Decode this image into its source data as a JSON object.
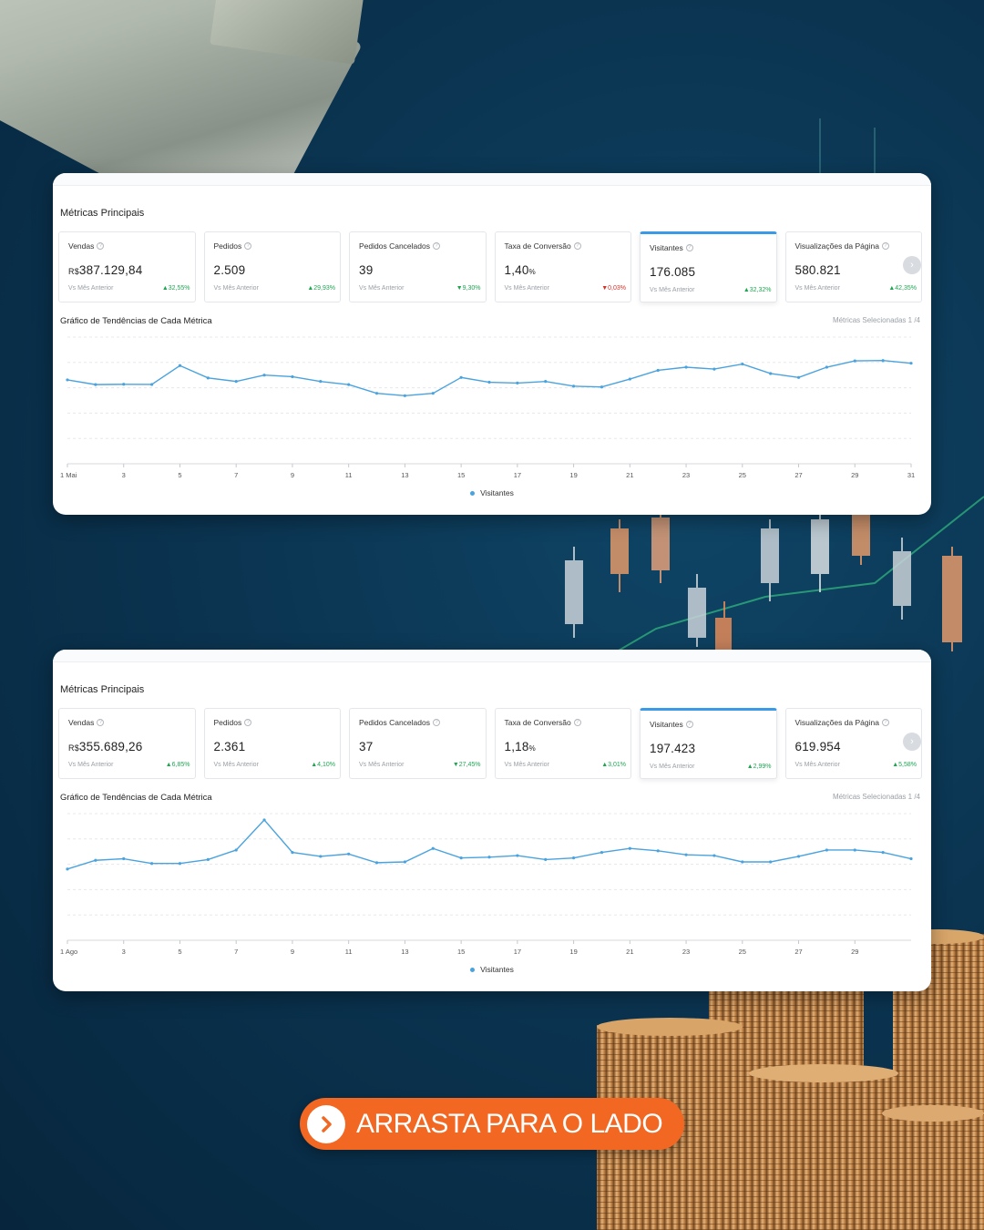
{
  "colors": {
    "accent": "#3b9ae8",
    "line": "#4aa3df",
    "up": "#1fa653",
    "down": "#d93025",
    "cta": "#f26722"
  },
  "panels": [
    {
      "section_title": "Métricas Principais",
      "cards": [
        {
          "label": "Vendas",
          "currency": "R$",
          "value": "387.129,84",
          "unit": "",
          "sub": "Vs Mês Anterior",
          "delta": "32,55%",
          "dir": "up",
          "active": false
        },
        {
          "label": "Pedidos",
          "currency": "",
          "value": "2.509",
          "unit": "",
          "sub": "Vs Mês Anterior",
          "delta": "29,93%",
          "dir": "up",
          "active": false
        },
        {
          "label": "Pedidos Cancelados",
          "currency": "",
          "value": "39",
          "unit": "",
          "sub": "Vs Mês Anterior",
          "delta": "9,30%",
          "dir": "down-green",
          "active": false
        },
        {
          "label": "Taxa de Conversão",
          "currency": "",
          "value": "1,40",
          "unit": "%",
          "sub": "Vs Mês Anterior",
          "delta": "0,03%",
          "dir": "down",
          "active": false
        },
        {
          "label": "Visitantes",
          "currency": "",
          "value": "176.085",
          "unit": "",
          "sub": "Vs Mês Anterior",
          "delta": "32,32%",
          "dir": "up",
          "active": true
        },
        {
          "label": "Visualizações da Página",
          "currency": "",
          "value": "580.821",
          "unit": "",
          "sub": "Vs Mês Anterior",
          "delta": "42,35%",
          "dir": "up",
          "active": false
        }
      ],
      "chart_title": "Gráfico de Tendências de Cada Métrica",
      "chart_selected": "Métricas Selecionadas 1 /4",
      "legend": "Visitantes",
      "next_icon": "chevron-right-icon"
    },
    {
      "section_title": "Métricas Principais",
      "cards": [
        {
          "label": "Vendas",
          "currency": "R$",
          "value": "355.689,26",
          "unit": "",
          "sub": "Vs Mês Anterior",
          "delta": "6,85%",
          "dir": "up",
          "active": false
        },
        {
          "label": "Pedidos",
          "currency": "",
          "value": "2.361",
          "unit": "",
          "sub": "Vs Mês Anterior",
          "delta": "4,10%",
          "dir": "up",
          "active": false
        },
        {
          "label": "Pedidos Cancelados",
          "currency": "",
          "value": "37",
          "unit": "",
          "sub": "Vs Mês Anterior",
          "delta": "27,45%",
          "dir": "down-green",
          "active": false
        },
        {
          "label": "Taxa de Conversão",
          "currency": "",
          "value": "1,18",
          "unit": "%",
          "sub": "Vs Mês Anterior",
          "delta": "3,01%",
          "dir": "up",
          "active": false
        },
        {
          "label": "Visitantes",
          "currency": "",
          "value": "197.423",
          "unit": "",
          "sub": "Vs Mês Anterior",
          "delta": "2,99%",
          "dir": "up",
          "active": true
        },
        {
          "label": "Visualizações da Página",
          "currency": "",
          "value": "619.954",
          "unit": "",
          "sub": "Vs Mês Anterior",
          "delta": "5,58%",
          "dir": "up",
          "active": false
        }
      ],
      "chart_title": "Gráfico de Tendências de Cada Métrica",
      "chart_selected": "Métricas Selecionadas 1 /4",
      "legend": "Visitantes",
      "next_icon": "chevron-right-icon"
    }
  ],
  "chart_data": [
    {
      "type": "line",
      "x": [
        1,
        2,
        3,
        4,
        5,
        6,
        7,
        8,
        9,
        10,
        11,
        12,
        13,
        14,
        15,
        16,
        17,
        18,
        19,
        20,
        21,
        22,
        23,
        24,
        25,
        26,
        27,
        28,
        29,
        30,
        31
      ],
      "tick_labels": [
        "1 Mai",
        "3",
        "5",
        "7",
        "9",
        "11",
        "13",
        "15",
        "17",
        "19",
        "21",
        "23",
        "25",
        "27",
        "29",
        "31"
      ],
      "tick_positions": [
        1,
        3,
        5,
        7,
        9,
        11,
        13,
        15,
        17,
        19,
        21,
        23,
        25,
        27,
        29,
        31
      ],
      "series": [
        {
          "name": "Visitantes",
          "values": [
            5300,
            5000,
            5020,
            5010,
            6200,
            5420,
            5200,
            5600,
            5500,
            5200,
            5000,
            4450,
            4300,
            4450,
            5450,
            5150,
            5100,
            5200,
            4900,
            4850,
            5350,
            5900,
            6100,
            5980,
            6300,
            5700,
            5450,
            6100,
            6500,
            6520,
            6350
          ]
        }
      ],
      "ylim": [
        0,
        8000
      ]
    },
    {
      "type": "line",
      "x": [
        1,
        2,
        3,
        4,
        5,
        6,
        7,
        8,
        9,
        10,
        11,
        12,
        13,
        14,
        15,
        16,
        17,
        18,
        19,
        20,
        21,
        22,
        23,
        24,
        25,
        26,
        27,
        28,
        29,
        30,
        31
      ],
      "tick_labels": [
        "1 Ago",
        "3",
        "5",
        "7",
        "9",
        "11",
        "13",
        "15",
        "17",
        "19",
        "21",
        "23",
        "25",
        "27",
        "29"
      ],
      "tick_positions": [
        1,
        3,
        5,
        7,
        9,
        11,
        13,
        15,
        17,
        19,
        21,
        23,
        25,
        27,
        29
      ],
      "series": [
        {
          "name": "Visitantes",
          "values": [
            4500,
            5050,
            5150,
            4850,
            4850,
            5100,
            5700,
            7600,
            5550,
            5300,
            5450,
            4900,
            4950,
            5800,
            5200,
            5250,
            5350,
            5100,
            5200,
            5550,
            5800,
            5650,
            5400,
            5350,
            4950,
            4950,
            5300,
            5700,
            5700,
            5550,
            5150
          ]
        }
      ],
      "ylim": [
        0,
        8000
      ]
    }
  ],
  "cta": {
    "label": "ARRASTA PARA O LADO",
    "icon": "chevron-right-icon"
  }
}
